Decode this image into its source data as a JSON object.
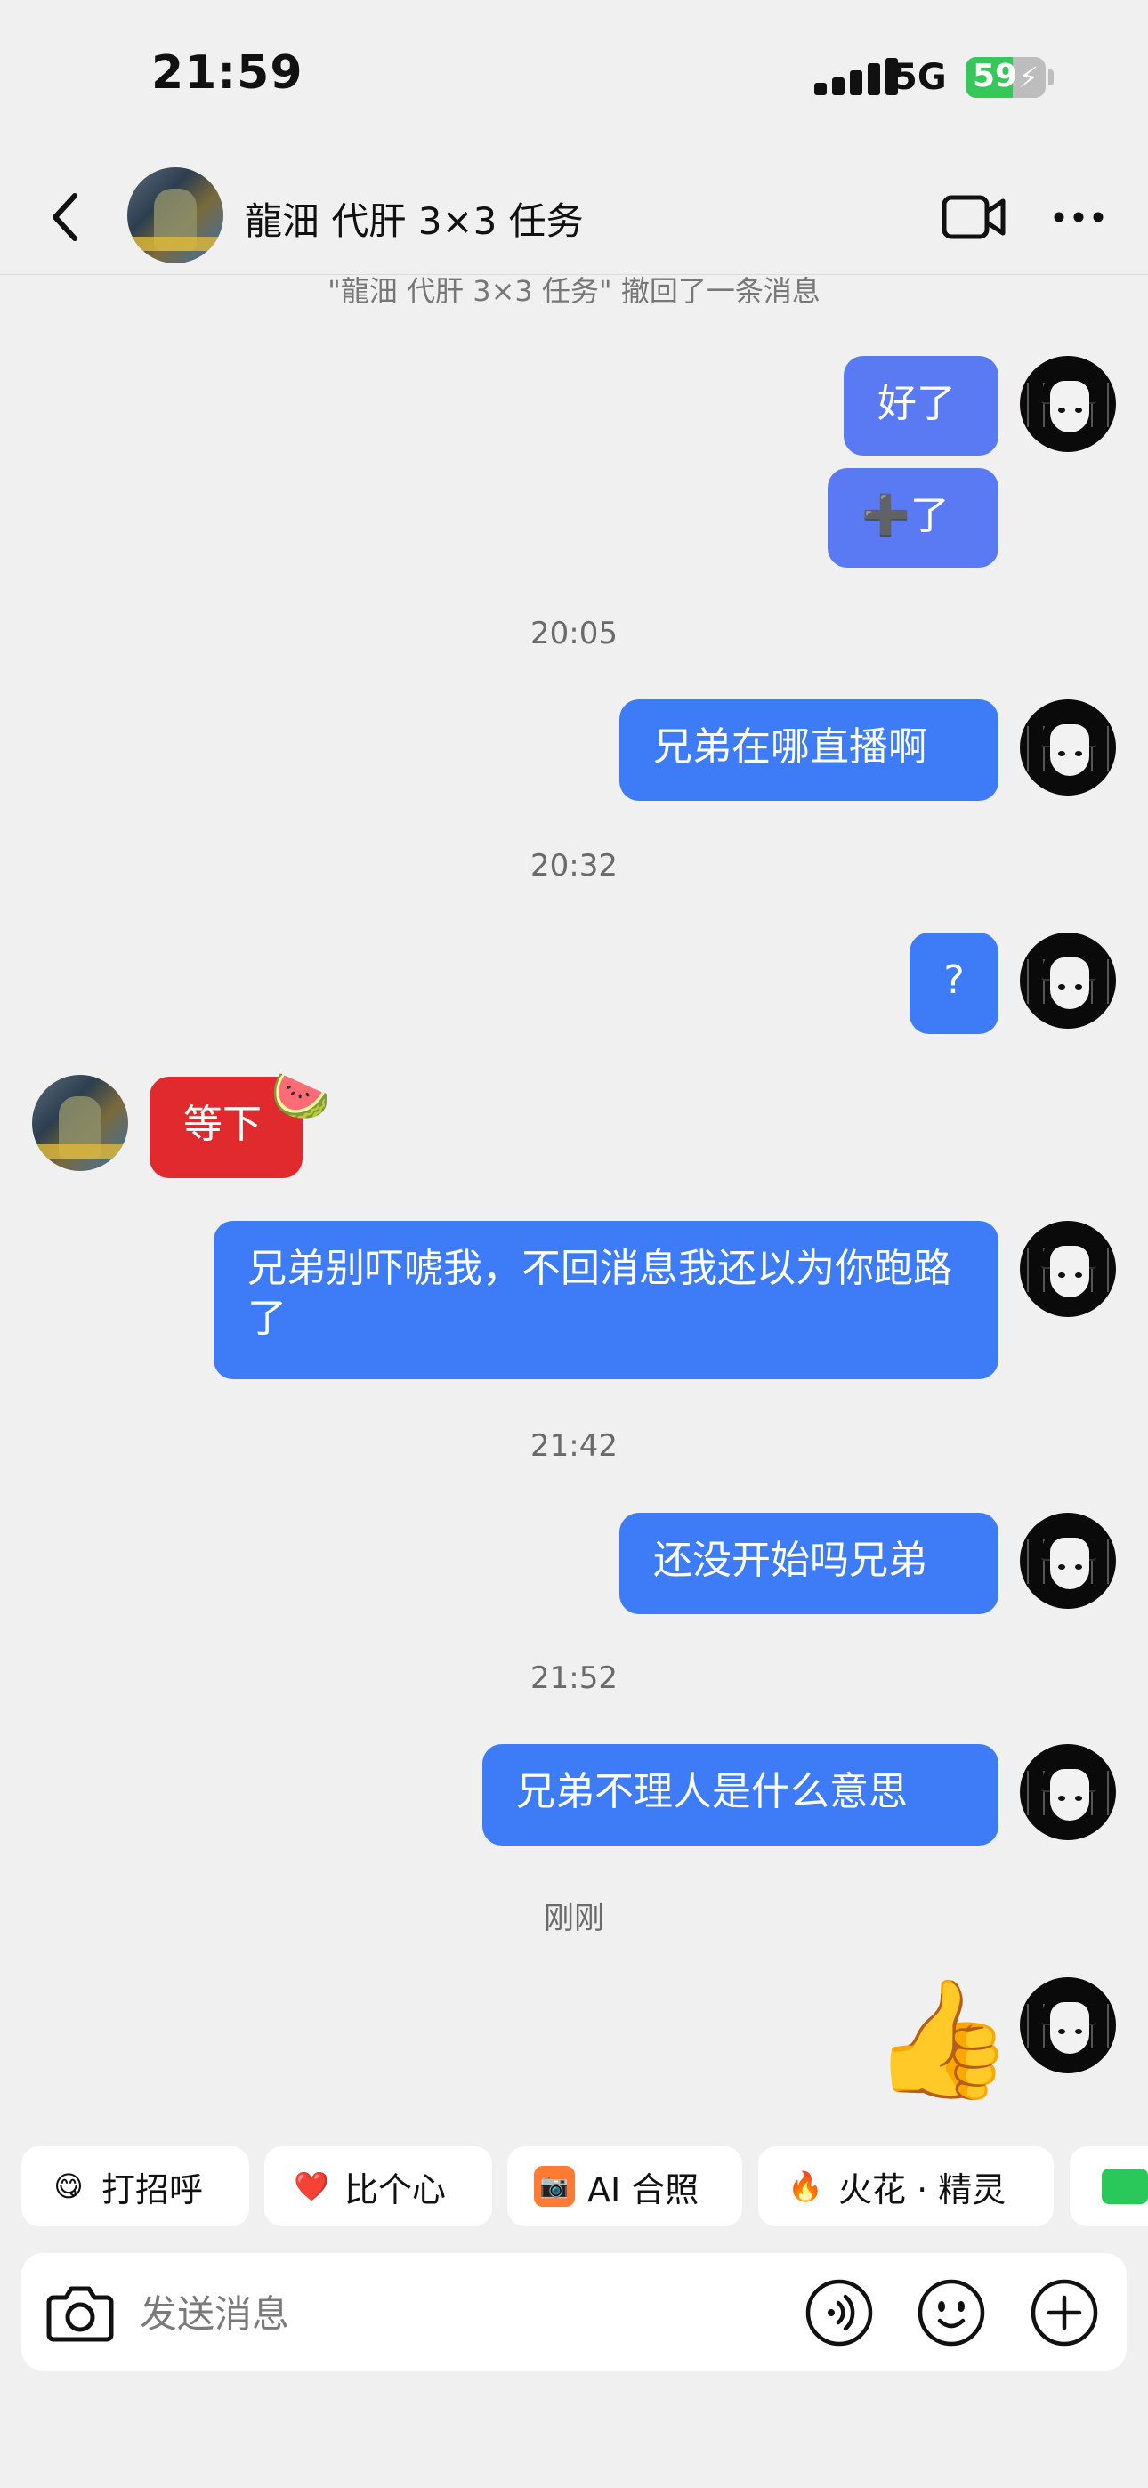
{
  "status_bar": {
    "time": "21:59",
    "network": "5G",
    "battery": "59",
    "battery_level": 0.59
  },
  "header": {
    "title": "龍沺 代肝 3×3 任务"
  },
  "system_note": "\"龍沺 代肝 3×3 任务\" 撤回了一条消息",
  "messages": {
    "m1": "好了",
    "m2": "➕了",
    "t1": "20:05",
    "m3": "兄弟在哪直播啊",
    "t2": "20:32",
    "m4": "?",
    "m5": "等下",
    "m5_sticker": "🍉",
    "m6": "兄弟别吓唬我，不回消息我还以为你跑路了",
    "t3": "21:42",
    "m7": "还没开始吗兄弟",
    "t4": "21:52",
    "m8": "兄弟不理人是什么意思",
    "t5": "刚刚",
    "m9": "👍"
  },
  "quick_replies": {
    "greet": {
      "icon": "😋",
      "label": "打招呼"
    },
    "heart": {
      "icon": "❤️",
      "label": "比个心"
    },
    "ai_photo": {
      "icon": "📷",
      "label": "AI 合照"
    },
    "spark": {
      "icon": "🔥",
      "label": "火花 · 精灵"
    }
  },
  "input": {
    "placeholder": "发送消息",
    "value": ""
  },
  "colors": {
    "bubble_blue": "#3d7cf6",
    "bubble_red": "#e02a2e",
    "background": "#f0f0f0"
  }
}
